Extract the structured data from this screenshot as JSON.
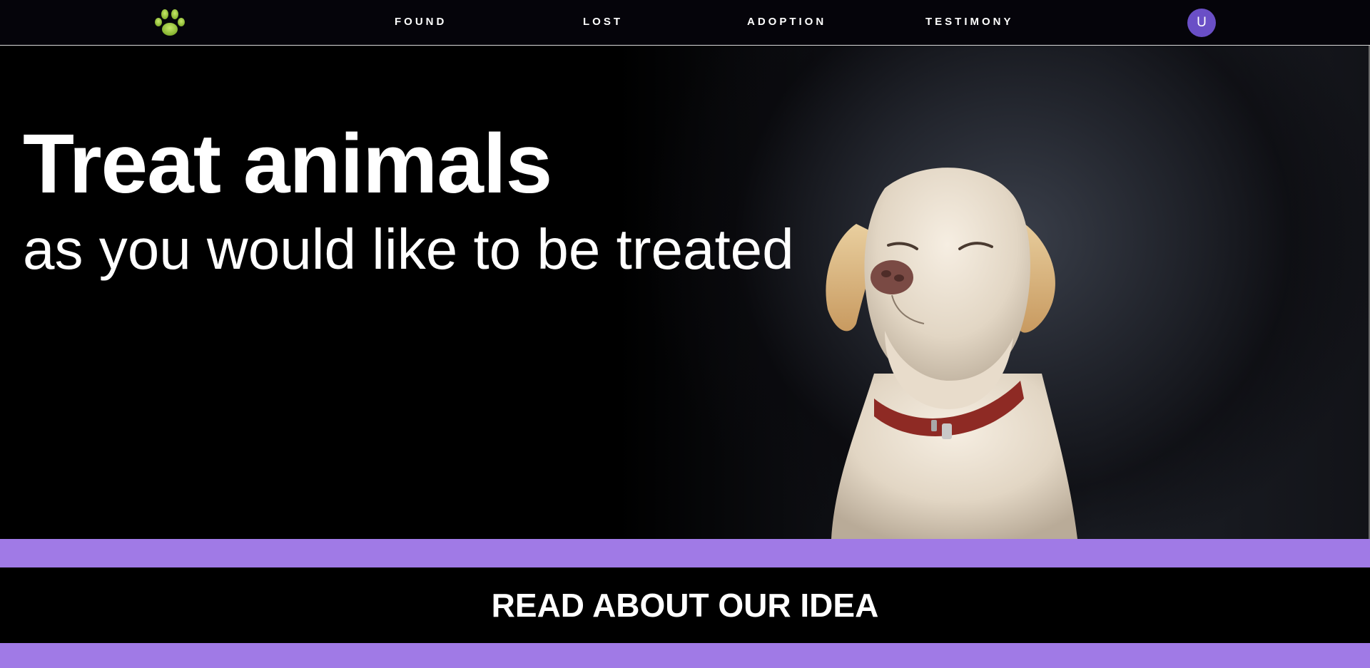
{
  "nav": {
    "links": [
      "FOUND",
      "LOST",
      "ADOPTION",
      "TESTIMONY"
    ],
    "avatar_initial": "U",
    "logo_icon": "paw-icon"
  },
  "hero": {
    "headline": "Treat animals",
    "subline": "as you would like to be treated",
    "image": "dog-photo"
  },
  "section": {
    "idea_title": "READ ABOUT OUR IDEA"
  },
  "colors": {
    "accent_purple": "#a07ae6",
    "avatar_bg": "#6a4fc6",
    "logo_green": "#9ccc3c",
    "background": "#05040a"
  }
}
